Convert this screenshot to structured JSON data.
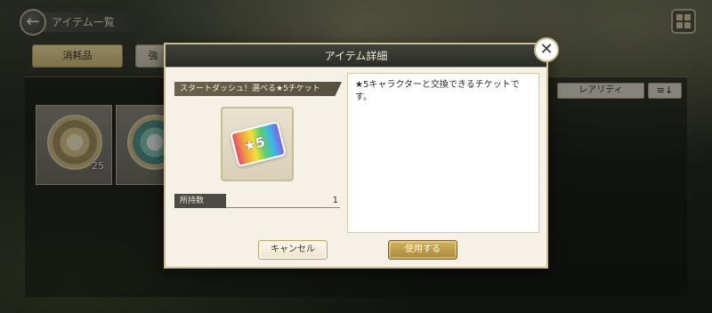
{
  "screen": {
    "title": "アイテム一覧",
    "back_icon": "back-arrow-icon",
    "menu_icon": "grid-menu-icon"
  },
  "tabs": [
    {
      "label": "消耗品",
      "active": true
    },
    {
      "label": "強",
      "active": false
    }
  ],
  "filters": {
    "rarity_label": "レアリティ",
    "sort_icon": "sort-descending-icon"
  },
  "items": [
    {
      "name": "gold-medal",
      "quantity": "25"
    },
    {
      "name": "teal-medal",
      "quantity": ""
    }
  ],
  "dialog": {
    "title": "アイテム詳細",
    "close_label": "✕",
    "item_name": "スタートダッシュ！選べる★5チケット",
    "ticket_text": "★5",
    "owned_label": "所持数",
    "owned_count": "1",
    "description": "★5キャラクターと交換できるチケットです。",
    "cancel_label": "キャンセル",
    "use_label": "使用する"
  },
  "colors": {
    "accent_gold": "#cbbd92",
    "header_dark": "#2b2d27",
    "use_button": "#a9873a"
  }
}
